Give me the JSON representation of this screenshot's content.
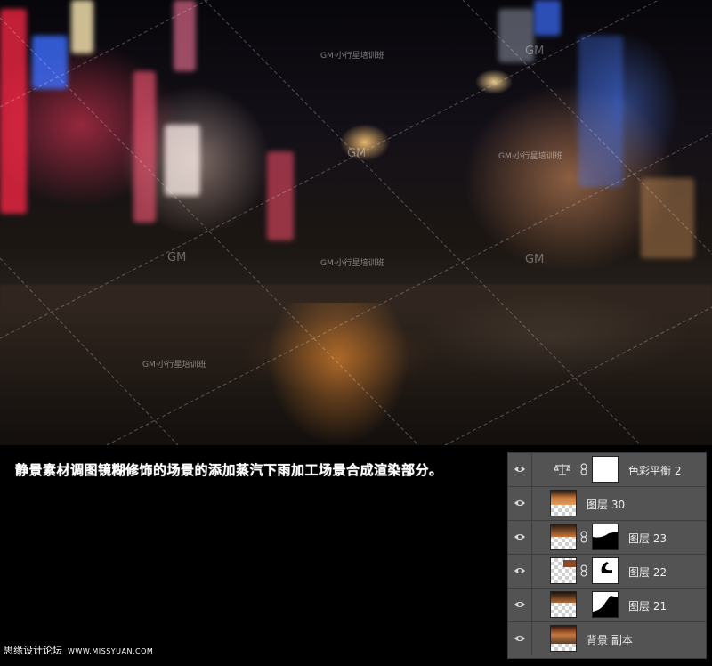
{
  "photo": {
    "watermarks": [
      "GM",
      "GM·小行星培训班",
      "GM",
      "GM·小行星培训班",
      "GM",
      "GM·小行星培训班",
      "GM",
      "GM·小行星培训班"
    ]
  },
  "caption": "静景素材调图镜糊修饰的场景的添加蒸汽下雨加工场景合成渲染部分。",
  "footer": {
    "brand": "思缘设计论坛",
    "site": "WWW.MISSYUAN.COM"
  },
  "layers": {
    "rows": [
      {
        "name": "色彩平衡 2",
        "type": "adjustment",
        "visible": true
      },
      {
        "name": "图层 30",
        "type": "image",
        "visible": true
      },
      {
        "name": "图层 23",
        "type": "masked",
        "visible": true
      },
      {
        "name": "图层 22",
        "type": "masked",
        "visible": true
      },
      {
        "name": "图层 21",
        "type": "masked",
        "visible": true
      },
      {
        "name": "背景 副本",
        "type": "image",
        "visible": true
      }
    ]
  },
  "colors": {
    "panel_bg": "#535353",
    "panel_border": "#3d3d3d",
    "page_bg": "#000000",
    "text": "#ffffff"
  }
}
